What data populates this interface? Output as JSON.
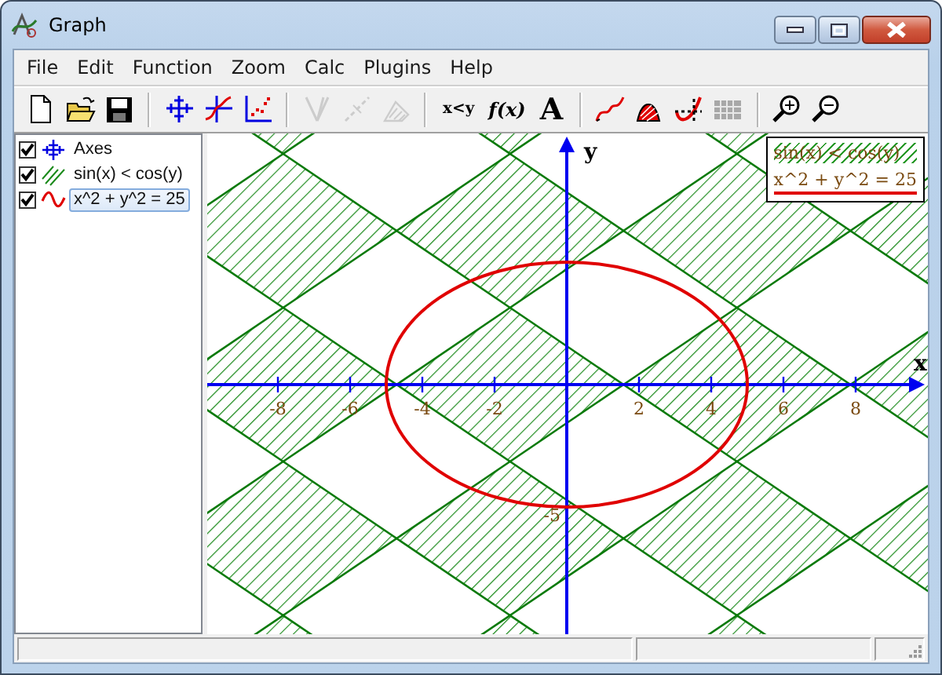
{
  "window": {
    "title": "Graph"
  },
  "menu": [
    "File",
    "Edit",
    "Function",
    "Zoom",
    "Calc",
    "Plugins",
    "Help"
  ],
  "toolbar": [
    [
      {
        "kind": "new",
        "disabled": false
      },
      {
        "kind": "open",
        "disabled": false
      },
      {
        "kind": "save",
        "disabled": false
      }
    ],
    [
      {
        "kind": "axes",
        "disabled": false
      },
      {
        "kind": "function",
        "disabled": false
      },
      {
        "kind": "points",
        "disabled": false
      }
    ],
    [
      {
        "kind": "tangent",
        "disabled": true
      },
      {
        "kind": "dashed",
        "disabled": true
      },
      {
        "kind": "shade",
        "disabled": true
      }
    ],
    [
      {
        "kind": "insert_relation",
        "label": "x<y",
        "disabled": false
      },
      {
        "kind": "insert_function",
        "label": "f(x)",
        "disabled": false
      },
      {
        "kind": "insert_label",
        "label": "A",
        "disabled": false
      }
    ],
    [
      {
        "kind": "curve",
        "disabled": false
      },
      {
        "kind": "area",
        "disabled": false
      },
      {
        "kind": "trace",
        "disabled": false
      },
      {
        "kind": "table",
        "disabled": false
      }
    ],
    [
      {
        "kind": "zoom_in",
        "disabled": false
      },
      {
        "kind": "zoom_out",
        "disabled": false
      }
    ]
  ],
  "functions": [
    {
      "kind": "axes",
      "label": "Axes",
      "checked": true,
      "selected": false
    },
    {
      "kind": "relation",
      "label": "sin(x) < cos(y)",
      "checked": true,
      "selected": false
    },
    {
      "kind": "curve",
      "label": "x^2 + y^2 = 25",
      "checked": true,
      "selected": true
    }
  ],
  "graph": {
    "x_axis": {
      "label": "x",
      "tick_labels": [
        "-8",
        "-6",
        "-4",
        "-2",
        "2",
        "4",
        "6",
        "8"
      ]
    },
    "y_axis": {
      "label": "y",
      "tick_labels": [
        "-5"
      ]
    },
    "legend": [
      {
        "kind": "relation",
        "label": "sin(x) < cos(y)"
      },
      {
        "kind": "curve",
        "label": "x^2 + y^2 = 25"
      }
    ]
  }
}
